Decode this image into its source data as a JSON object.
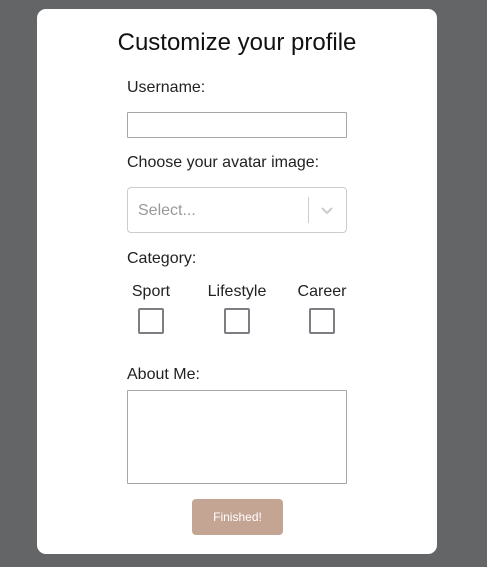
{
  "form": {
    "title": "Customize your profile",
    "username": {
      "label": "Username:",
      "value": ""
    },
    "avatar": {
      "label": "Choose your avatar image:",
      "placeholder": "Select...",
      "icon": "chevron-down-icon"
    },
    "category": {
      "label": "Category:",
      "options": [
        {
          "label": "Sport",
          "checked": false
        },
        {
          "label": "Lifestyle",
          "checked": false
        },
        {
          "label": "Career",
          "checked": false
        }
      ]
    },
    "about": {
      "label": "About Me:",
      "value": ""
    },
    "submit_label": "Finished!"
  },
  "colors": {
    "background": "#646566",
    "card": "#ffffff",
    "button": "#c4a594",
    "button_text": "#ffffff"
  }
}
